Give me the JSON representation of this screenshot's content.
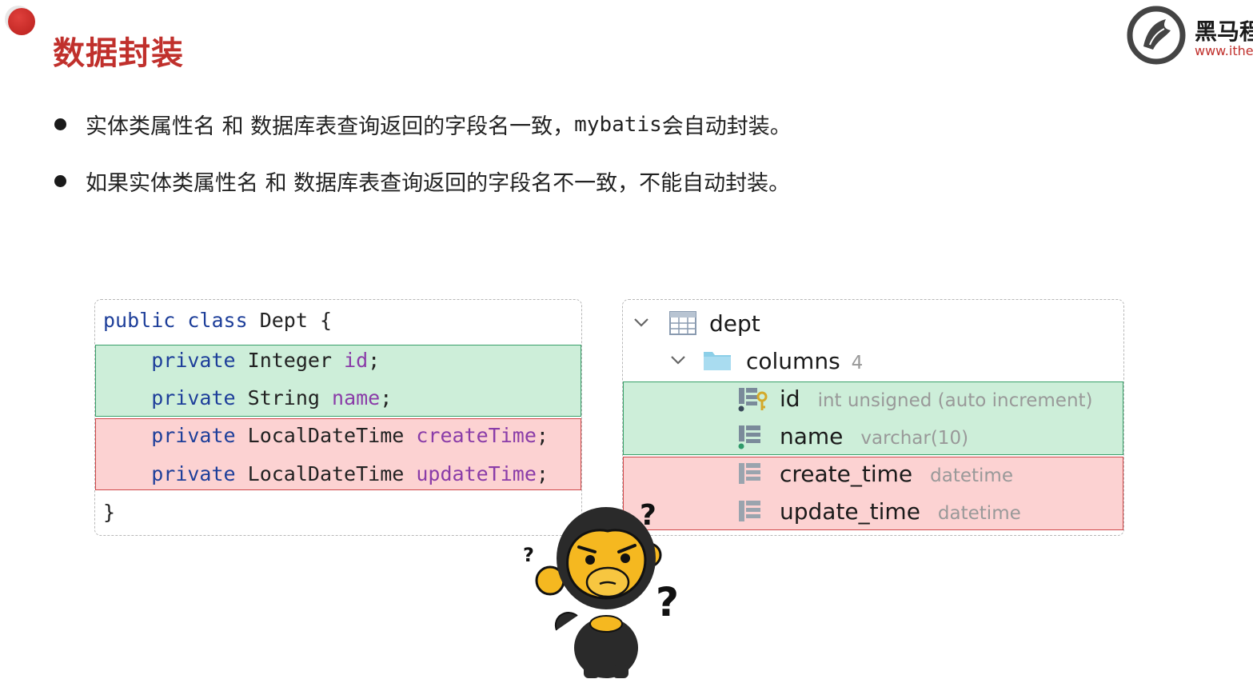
{
  "slide": {
    "title": "数据封装",
    "logo_cn": "黑马程序员",
    "logo_url": "www.itheima.com"
  },
  "bullets": [
    {
      "text_before": "实体类属性名 和 数据库表查询返回的字段名一致，",
      "mono": "mybatis",
      "text_after": "会自动封装。"
    },
    {
      "text": "如果实体类属性名 和 数据库表查询返回的字段名不一致，不能自动封装。"
    }
  ],
  "code": {
    "line1": {
      "kw1": "public",
      "kw2": "class",
      "name": "Dept",
      "brace": "{"
    },
    "fields": [
      {
        "kw": "private",
        "type": "Integer",
        "name": "id",
        "end": ";"
      },
      {
        "kw": "private",
        "type": "String",
        "name": "name",
        "end": ";"
      },
      {
        "kw": "private",
        "type": "LocalDateTime",
        "name": "createTime",
        "end": ";"
      },
      {
        "kw": "private",
        "type": "LocalDateTime",
        "name": "updateTime",
        "end": ";"
      }
    ],
    "close": "}"
  },
  "db": {
    "table": "dept",
    "folder": "columns",
    "count": "4",
    "columns": [
      {
        "name": "id",
        "type": "int unsigned (auto increment)",
        "icon": "primary-key-column-icon"
      },
      {
        "name": "name",
        "type": "varchar(10)",
        "icon": "column-icon"
      },
      {
        "name": "create_time",
        "type": "datetime",
        "icon": "column-icon"
      },
      {
        "name": "update_time",
        "type": "datetime",
        "icon": "column-icon"
      }
    ]
  },
  "colors": {
    "title_red": "#c0302c",
    "match_green": "#cdeed9",
    "mismatch_red": "#fcd2d2",
    "keyword_blue": "#1e3f9a",
    "field_purple": "#8a3ca8"
  },
  "mascot": {
    "marks": [
      "?",
      "?",
      "?"
    ]
  }
}
